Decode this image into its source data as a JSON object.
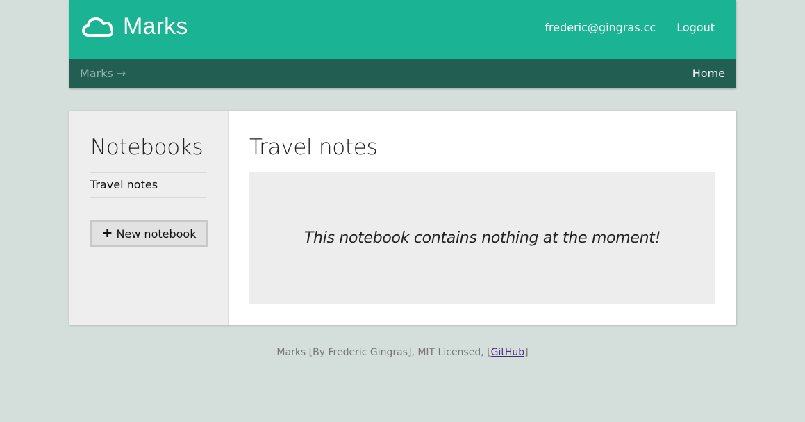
{
  "header": {
    "brand": "Marks",
    "user_email": "frederic@gingras.cc",
    "logout_label": "Logout",
    "breadcrumb": "Marks →",
    "home_label": "Home",
    "accent_color": "#1ab394",
    "subbar_color": "#225f52"
  },
  "sidebar": {
    "title": "Notebooks",
    "notebooks": [
      {
        "label": "Travel notes"
      }
    ],
    "new_button_icon": "+",
    "new_button_label": "New notebook"
  },
  "main": {
    "title": "Travel notes",
    "empty_message": "This notebook contains nothing at the moment!"
  },
  "footer": {
    "prefix": "Marks [By Frederic Gingras], MIT Licensed, [",
    "link_label": "GitHub",
    "suffix": "]"
  },
  "icons": {
    "logo": "cloud-icon",
    "new_button": "plus-icon"
  }
}
